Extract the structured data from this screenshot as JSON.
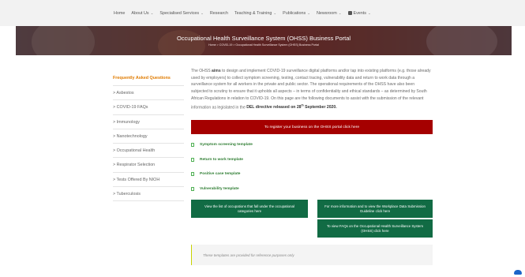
{
  "nav": {
    "items": [
      {
        "label": "Home",
        "has_menu": false
      },
      {
        "label": "About Us",
        "has_menu": true
      },
      {
        "label": "Specialised Services",
        "has_menu": true
      },
      {
        "label": "Research",
        "has_menu": false
      },
      {
        "label": "Teaching & Training",
        "has_menu": true
      },
      {
        "label": "Publications",
        "has_menu": true
      },
      {
        "label": "Newsroom",
        "has_menu": true
      },
      {
        "label": "Events",
        "has_menu": true
      }
    ]
  },
  "hero": {
    "title": "Occupational Health Surveillance System (OHSS) Business Portal",
    "breadcrumb": "Home > COVID-19 > Occupational Health Surveillance System (OHSS) Business Portal"
  },
  "sidebar": {
    "heading": "Frequently Asked Questions",
    "items": [
      "> Asbestos",
      "> COVID-19 FAQs",
      "> Immunology",
      "> Nanotechnology",
      "> Occupational Health",
      "> Respirator Selection",
      "> Tests Offered By NIOH",
      "> Tuberculosis"
    ]
  },
  "main": {
    "intro_1": "The OHSS ",
    "intro_bold": "aims",
    "intro_2": " to design and implement COVID-19 surveillance digital platforms and/or tap into existing platforms (e.g. those already used by employers) to collect symptom screening, testing, contact tracing, vulnerability data and return to work data through a surveillance system for all workers in the private and public sector. The operational requirements of the OHSS have also been subjected to scrutiny to ensure that it upholds all aspects – in terms of confidentiality and ethical standards – as determined by South African Regulations in relation to COVID-19. On this page are the following documents to assist with the submission of the relevant information as legislated in the ",
    "intro_directive": "DEL directive released on 28",
    "intro_sup": "th",
    "intro_directive_end": " September 2020.",
    "register_button": "To register your business on the OHSS portal click here",
    "templates": [
      "Symptom screening template",
      "Return to work template",
      "Positive case template",
      "Vulnerability template"
    ],
    "btn_occupations": "View the list of occupations that fall under the occupational categories here",
    "btn_guideline": "For more information and to view the Workplace Data Submission Guideline click here",
    "btn_faqs": "To view FAQs on the Occupational Health Surveillance System (OHSS) click here",
    "note": "These templates are provided for reference purposes only"
  }
}
